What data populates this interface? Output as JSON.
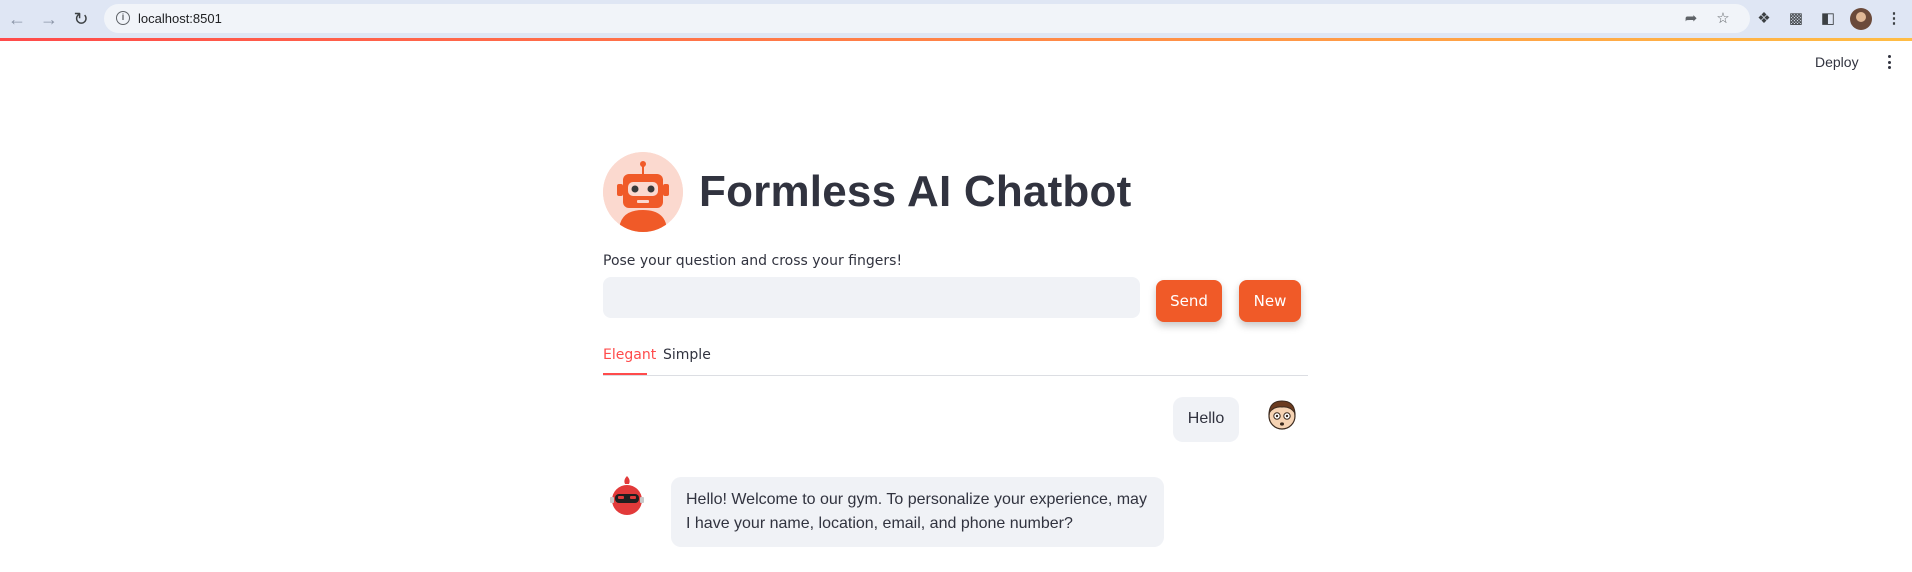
{
  "browser": {
    "url": "localhost:8501"
  },
  "header": {
    "deploy_label": "Deploy"
  },
  "app": {
    "title": "Formless AI Chatbot",
    "prompt_label": "Pose your question and cross your fingers!",
    "input_value": "",
    "send_label": "Send",
    "new_label": "New",
    "accent_color": "#f05a28",
    "tabs": [
      {
        "label": "Elegant",
        "active": true
      },
      {
        "label": "Simple",
        "active": false
      }
    ]
  },
  "chat": {
    "messages": [
      {
        "role": "user",
        "text": "Hello",
        "avatar": "user-avatar-icon"
      },
      {
        "role": "assistant",
        "text": "Hello! Welcome to our gym. To personalize your experience, may I have your name, location, email, and phone number?",
        "avatar": "robot-avatar-icon"
      }
    ]
  }
}
